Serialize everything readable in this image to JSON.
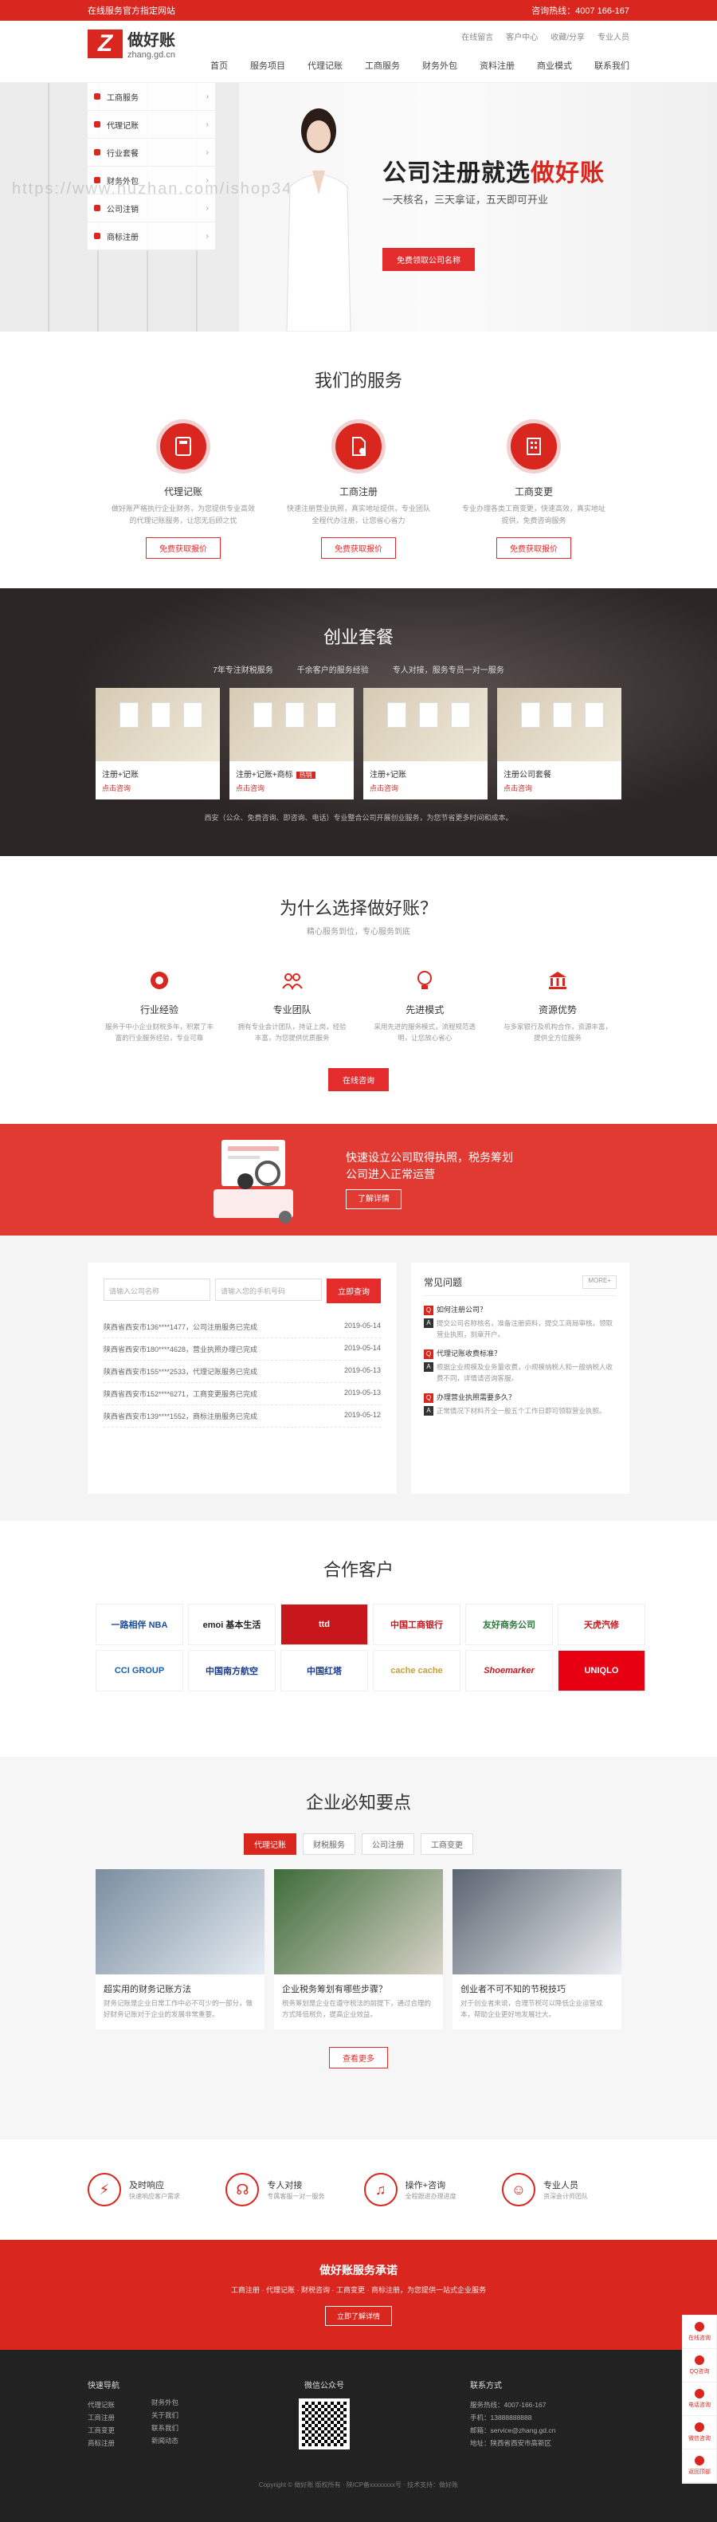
{
  "topbar": {
    "left": "在线服务官方指定网站",
    "right": "咨询热线：4007 166-167"
  },
  "logo": {
    "mark": "Z",
    "name": "做好账",
    "domain": "zhang.gd.cn"
  },
  "header_links": [
    "在线留言",
    "客户中心",
    "收藏/分享",
    "专业人员"
  ],
  "nav": [
    "首页",
    "服务项目",
    "代理记账",
    "工商服务",
    "财务外包",
    "资料注册",
    "商业模式",
    "联系我们"
  ],
  "category_menu": [
    {
      "label": "工商服务"
    },
    {
      "label": "代理记账"
    },
    {
      "label": "行业套餐"
    },
    {
      "label": "财务外包"
    },
    {
      "label": "公司注销"
    },
    {
      "label": "商标注册"
    }
  ],
  "hero": {
    "title_a": "公司注册就选",
    "title_b": "做好账",
    "subtitle": "一天核名，三天拿证，五天即可开业",
    "button": "免费领取公司名称",
    "watermark": "https://www.huzhan.com/ishop3489"
  },
  "services": {
    "title": "我们的服务",
    "items": [
      {
        "icon": "calculator-icon",
        "title": "代理记账",
        "desc": "做好账严格执行企业财务，为您提供专业高效的代理记账服务，让您无后顾之忧",
        "button": "免费获取报价"
      },
      {
        "icon": "document-icon",
        "title": "工商注册",
        "desc": "快速注册营业执照，真实地址提供，专业团队全程代办注册，让您省心省力",
        "button": "免费获取报价"
      },
      {
        "icon": "building-icon",
        "title": "工商变更",
        "desc": "专业办理各类工商变更，快速高效，真实地址提供，免费咨询服务",
        "button": "免费获取报价"
      }
    ]
  },
  "packages": {
    "title": "创业套餐",
    "tags": [
      "7年专注财税服务",
      "千余客户的服务经验",
      "专人对接，服务专员一对一服务"
    ],
    "cards": [
      {
        "title": "注册+记账",
        "badge": "",
        "price": "点击咨询"
      },
      {
        "title": "注册+记账+商标",
        "badge": "热销",
        "price": "点击咨询"
      },
      {
        "title": "注册+记账",
        "badge": "",
        "price": "点击咨询"
      },
      {
        "title": "注册公司套餐",
        "badge": "",
        "price": "点击咨询"
      }
    ],
    "note": "西安（公众、免费咨询、即咨询、电话）专业整合公司开展创业服务，为您节省更多时间和成本。"
  },
  "why": {
    "title": "为什么选择做好账？",
    "subtitle": "精心服务到位，专心服务到底",
    "items": [
      {
        "icon": "medal-icon",
        "title": "行业经验",
        "desc": "服务于中小企业财税多年，积累了丰富的行业服务经验，专业可靠"
      },
      {
        "icon": "team-icon",
        "title": "专业团队",
        "desc": "拥有专业会计团队，持证上岗，经验丰富，为您提供优质服务"
      },
      {
        "icon": "bulb-icon",
        "title": "先进模式",
        "desc": "采用先进的服务模式，流程规范透明，让您放心省心"
      },
      {
        "icon": "bank-icon",
        "title": "资源优势",
        "desc": "与多家银行及机构合作，资源丰富，提供全方位服务"
      }
    ],
    "button": "在线咨询"
  },
  "banner2": {
    "line1": "快速设立公司取得执照，税务筹划",
    "line2": "公司进入正常运营",
    "button": "了解详情"
  },
  "query": {
    "placeholder1": "请输入公司名称",
    "placeholder2": "请输入您的手机号码",
    "button": "立即查询",
    "rows": [
      {
        "text": "陕西省西安市136****1477，公司注册服务已完成",
        "date": "2019-05-14"
      },
      {
        "text": "陕西省西安市180****4628，营业执照办理已完成",
        "date": "2019-05-14"
      },
      {
        "text": "陕西省西安市155****2533，代理记账服务已完成",
        "date": "2019-05-13"
      },
      {
        "text": "陕西省西安市152****6271，工商变更服务已完成",
        "date": "2019-05-13"
      },
      {
        "text": "陕西省西安市139****1552，商标注册服务已完成",
        "date": "2019-05-12"
      }
    ]
  },
  "faq": {
    "title": "常见问题",
    "more": "MORE+",
    "items": [
      {
        "q": "如何注册公司？",
        "a": "提交公司名称核名，准备注册资料，提交工商局审核，领取营业执照，刻章开户。"
      },
      {
        "q": "代理记账收费标准？",
        "a": "根据企业规模及业务量收费，小规模纳税人和一般纳税人收费不同，详情请咨询客服。"
      },
      {
        "q": "办理营业执照需要多久？",
        "a": "正常情况下材料齐全一般五个工作日即可领取营业执照。"
      }
    ]
  },
  "clients": {
    "title": "合作客户",
    "logos": [
      "一路相伴 NBA",
      "emoi 基本生活",
      "ttd",
      "中国工商银行",
      "友好商务公司",
      "天虎汽修",
      "CCI GROUP",
      "中国南方航空",
      "中国红塔",
      "cache cache",
      "Shoemarker",
      "UNIQLO"
    ]
  },
  "knowledge": {
    "title": "企业必知要点",
    "tabs": [
      "代理记账",
      "财税服务",
      "公司注册",
      "工商变更"
    ],
    "articles": [
      {
        "title": "超实用的财务记账方法",
        "desc": "财务记账是企业日常工作中必不可少的一部分，做好财务记账对于企业的发展非常重要。"
      },
      {
        "title": "企业税务筹划有哪些步骤？",
        "desc": "税务筹划是企业在遵守税法的前提下，通过合理的方式降低税负，提高企业效益。"
      },
      {
        "title": "创业者不可不知的节税技巧",
        "desc": "对于创业者来说，合理节税可以降低企业运营成本，帮助企业更好地发展壮大。"
      }
    ],
    "button": "查看更多"
  },
  "features": [
    {
      "icon": "bolt-icon",
      "title": "及时响应",
      "desc": "快速响应客户需求"
    },
    {
      "icon": "headset-icon",
      "title": "专人对接",
      "desc": "专属客服一对一服务"
    },
    {
      "icon": "bell-icon",
      "title": "操作+咨询",
      "desc": "全程跟进办理进度"
    },
    {
      "icon": "user-icon",
      "title": "专业人员",
      "desc": "资深会计师团队"
    }
  ],
  "promise": {
    "title": "做好账服务承诺",
    "line": "工商注册 · 代理记账 · 财税咨询 · 工商变更 · 商标注册，为您提供一站式企业服务",
    "button": "立即了解详情"
  },
  "footer": {
    "col1_title": "快速导航",
    "col1": [
      "代理记账",
      "工商注册",
      "工商变更",
      "商标注册"
    ],
    "col2": [
      "财务外包",
      "关于我们",
      "联系我们",
      "新闻动态"
    ],
    "qr_title": "微信公众号",
    "contact_title": "联系方式",
    "contact": [
      "服务热线：4007-166-167",
      "手机：13888888888",
      "邮箱：service@zhang.gd.cn",
      "地址：陕西省西安市高新区"
    ]
  },
  "copyright": "Copyright © 做好账 版权所有 · 陕ICP备xxxxxxxx号 · 技术支持：做好账",
  "side": [
    "在线咨询",
    "QQ咨询",
    "电话咨询",
    "微信咨询",
    "返回顶部"
  ],
  "colors": {
    "brand": "#d9261f",
    "dark": "#222222"
  }
}
